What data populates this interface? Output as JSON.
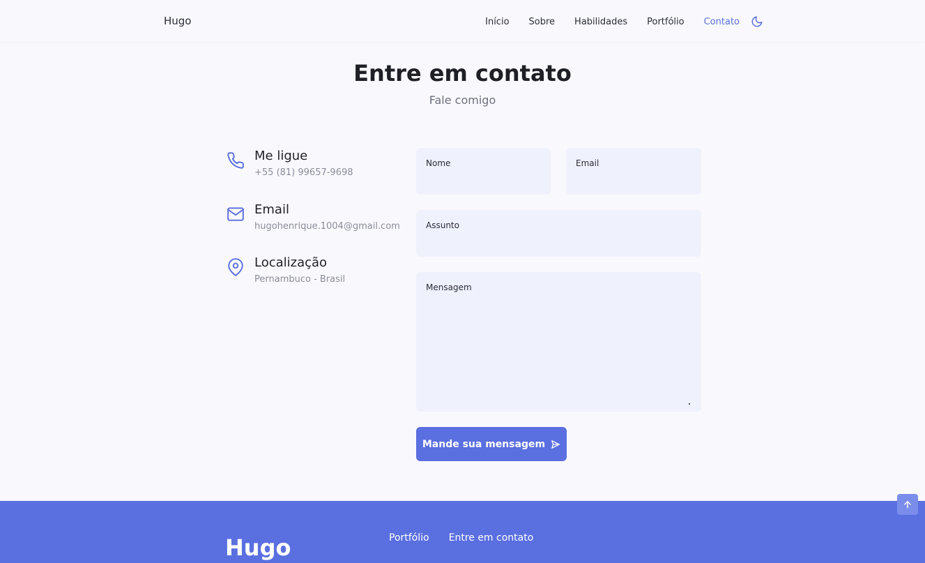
{
  "header": {
    "logo": "Hugo",
    "nav": [
      "Início",
      "Sobre",
      "Habilidades",
      "Portfólio",
      "Contato"
    ],
    "active_nav": "Contato",
    "theme_icon": "moon-icon"
  },
  "section": {
    "title": "Entre em contato",
    "subtitle": "Fale comigo"
  },
  "contact_info": [
    {
      "icon": "phone-icon",
      "title": "Me ligue",
      "value": "+55 (81) 99657-9698"
    },
    {
      "icon": "mail-icon",
      "title": "Email",
      "value": "hugohenrique.1004@gmail.com"
    },
    {
      "icon": "map-pin-icon",
      "title": "Localização",
      "value": "Pernambuco - Brasil"
    }
  ],
  "form": {
    "name_label": "Nome",
    "email_label": "Email",
    "subject_label": "Assunto",
    "message_label": "Mensagem",
    "submit_label": "Mande sua mensagem",
    "submit_icon": "send-icon"
  },
  "footer": {
    "logo": "Hugo",
    "links": [
      "Portfólio",
      "Entre em contato"
    ]
  },
  "scroll_up_icon": "arrow-up-icon",
  "colors": {
    "accent": "#5a6fe0",
    "field_bg": "#eff1fc",
    "page_bg": "#f9f9fd"
  }
}
